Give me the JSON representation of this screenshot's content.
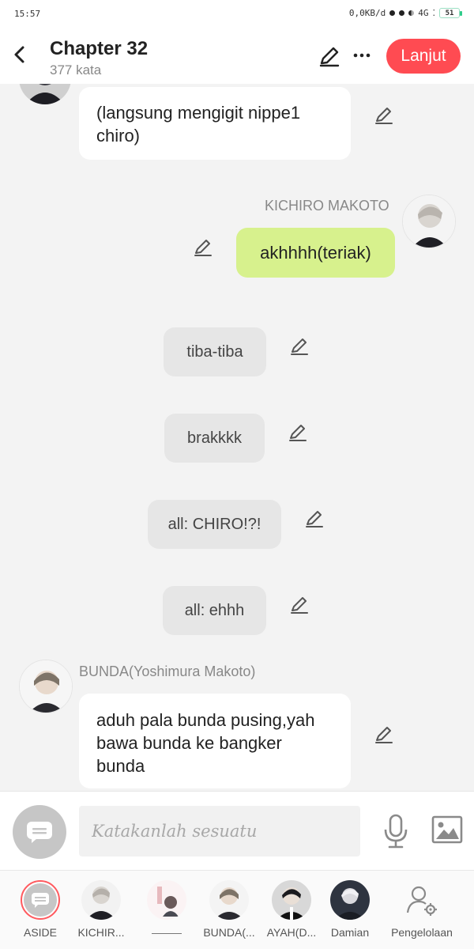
{
  "status": {
    "time": "15:57",
    "net": "0,0KB/d",
    "signal": "4G",
    "battery": "51"
  },
  "header": {
    "title": "Chapter 32",
    "subtitle": "377 kata",
    "next_label": "Lanjut"
  },
  "messages": [
    {
      "type": "left",
      "text": "(langsung mengigit nippe1 chiro)"
    },
    {
      "type": "right",
      "name": "KICHIRO MAKOTO",
      "text": "akhhhh(teriak)"
    },
    {
      "type": "narration",
      "text": "tiba-tiba"
    },
    {
      "type": "narration",
      "text": "brakkkk"
    },
    {
      "type": "narration",
      "text": "all: CHIRO!?!"
    },
    {
      "type": "narration",
      "text": "all: ehhh"
    },
    {
      "type": "left",
      "name": "BUNDA(Yoshimura Makoto)",
      "text": "aduh pala bunda pusing,yah bawa bunda ke bangker bunda"
    }
  ],
  "input": {
    "placeholder": "Katakanlah sesuatu"
  },
  "tabs": [
    {
      "label": "ASIDE",
      "icon": "aside-icon"
    },
    {
      "label": "KICHIR...",
      "icon": "avatar-kichiro"
    },
    {
      "label": "",
      "icon": "avatar-blank"
    },
    {
      "label": "BUNDA(...",
      "icon": "avatar-bunda"
    },
    {
      "label": "AYAH(D...",
      "icon": "avatar-ayah"
    },
    {
      "label": "Damian",
      "icon": "avatar-damian"
    },
    {
      "label": "Pengelolaan",
      "icon": "user-gear-icon"
    }
  ],
  "colors": {
    "accent": "#ff4b52",
    "own_bubble": "#d7f18d",
    "narration_bubble": "#e6e6e6"
  }
}
